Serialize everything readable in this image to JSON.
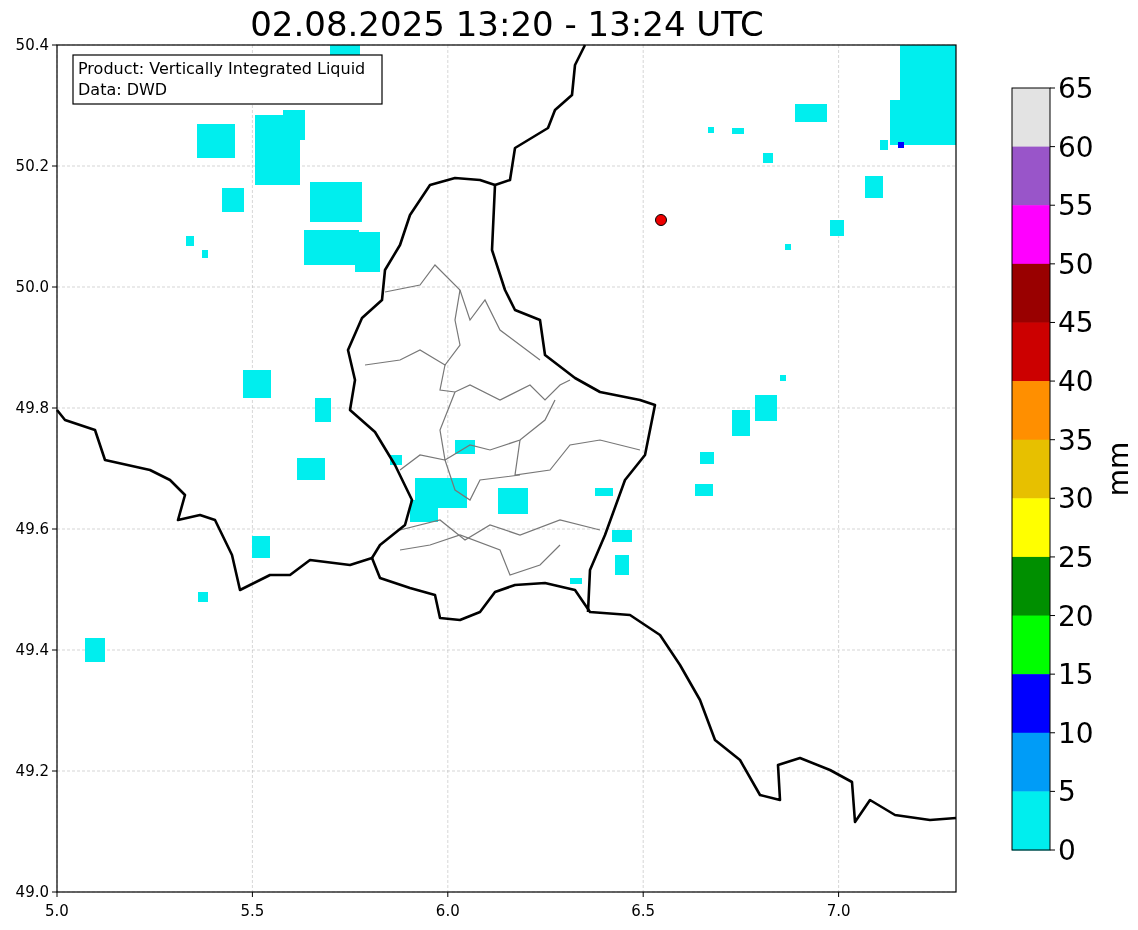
{
  "title": "02.08.2025 13:20 - 13:24 UTC",
  "annotation": [
    "Product: Vertically Integrated Liquid",
    "Data: DWD"
  ],
  "map": {
    "x_ticks": [
      "5.0",
      "5.5",
      "6.0",
      "6.5",
      "7.0"
    ],
    "y_ticks": [
      "50.4",
      "50.2",
      "50.0",
      "49.8",
      "49.6",
      "49.4",
      "49.2",
      "49.0"
    ]
  },
  "colorbar": {
    "label": "mm",
    "ticks": [
      "65",
      "60",
      "55",
      "50",
      "45",
      "40",
      "35",
      "30",
      "25",
      "20",
      "15",
      "10",
      "5",
      "0"
    ],
    "bins": [
      {
        "color": "#e3e3e3"
      },
      {
        "color": "#9955c9"
      },
      {
        "color": "#ff00ff"
      },
      {
        "color": "#990000"
      },
      {
        "color": "#cc0000"
      },
      {
        "color": "#ff8f00"
      },
      {
        "color": "#e7c000"
      },
      {
        "color": "#ffff00"
      },
      {
        "color": "#008f00"
      },
      {
        "color": "#00ff00"
      },
      {
        "color": "#0000ff"
      },
      {
        "color": "#009cf7"
      },
      {
        "color": "#00eeee"
      }
    ]
  }
}
